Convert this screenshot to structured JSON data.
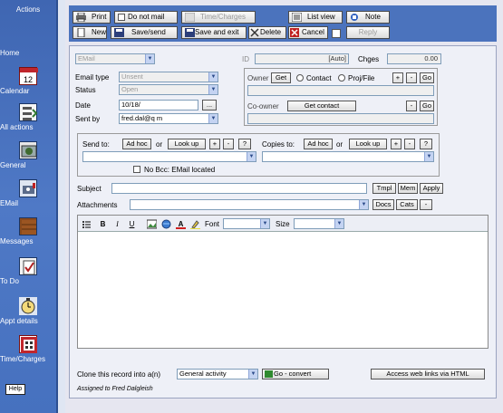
{
  "sidebar": {
    "header": "Actions",
    "items": [
      {
        "label": "Home",
        "icon": "home-icon"
      },
      {
        "label": "Calendar",
        "icon": "calendar-icon"
      },
      {
        "label": "All actions",
        "icon": "all-actions-icon"
      },
      {
        "label": "General",
        "icon": "general-icon"
      },
      {
        "label": "EMail",
        "icon": "email-icon"
      },
      {
        "label": "Messages",
        "icon": "messages-icon"
      },
      {
        "label": "To Do",
        "icon": "todo-icon"
      },
      {
        "label": "Appt details",
        "icon": "appointment-icon"
      },
      {
        "label": "Time/Charges",
        "icon": "time-charges-icon"
      }
    ],
    "help": "Help"
  },
  "toolbar": {
    "print": "Print",
    "do_not_mail": "Do not mail",
    "time_charges": "Time/Charges",
    "list_view": "List view",
    "note": "Note",
    "new": "New",
    "save_send": "Save/send",
    "save_exit": "Save and exit",
    "delete": "Delete",
    "cancel": "Cancel",
    "reply": "Reply"
  },
  "form": {
    "type_value": "EMail",
    "id_label": "ID",
    "id_value": "[Auto]",
    "chges_label": "Chges",
    "chges_value": "0.00",
    "email_type_label": "Email type",
    "email_type_value": "Unsent",
    "status_label": "Status",
    "status_value": "Open",
    "date_label": "Date",
    "date_value": "10/18/",
    "date_button": "...",
    "sent_by_label": "Sent by",
    "sent_by_value": "fred.dal@q          m",
    "owner_label": "Owner",
    "owner_get": "Get",
    "contact_label": "Contact",
    "proj_file_label": "Proj/File",
    "plus": "+",
    "minus": "-",
    "go": "Go",
    "coowner_label": "Co-owner",
    "get_contact": "Get contact",
    "send_to_label": "Send to:",
    "ad_hoc": "Ad hoc",
    "or": "or",
    "look_up": "Look up",
    "question": "?",
    "copies_to_label": "Copies to:",
    "no_bcc_label": "No Bcc: EMail located",
    "subject_label": "Subject",
    "tmpl": "Tmpl",
    "mem": "Mem",
    "apply": "Apply",
    "attachments_label": "Attachments",
    "docs": "Docs",
    "cats": "Cats",
    "font_label": "Font",
    "size_label": "Size",
    "clone_label": "Clone this record into a(n)",
    "clone_value": "General activity",
    "go_convert": "Go - convert",
    "web_links": "Access web links via HTML",
    "assigned": "Assigned to Fred Dalgleish"
  },
  "colors": {
    "sidebar": "#4a74c0",
    "toolbar": "#4b73bd",
    "panel": "#eef0f7"
  }
}
